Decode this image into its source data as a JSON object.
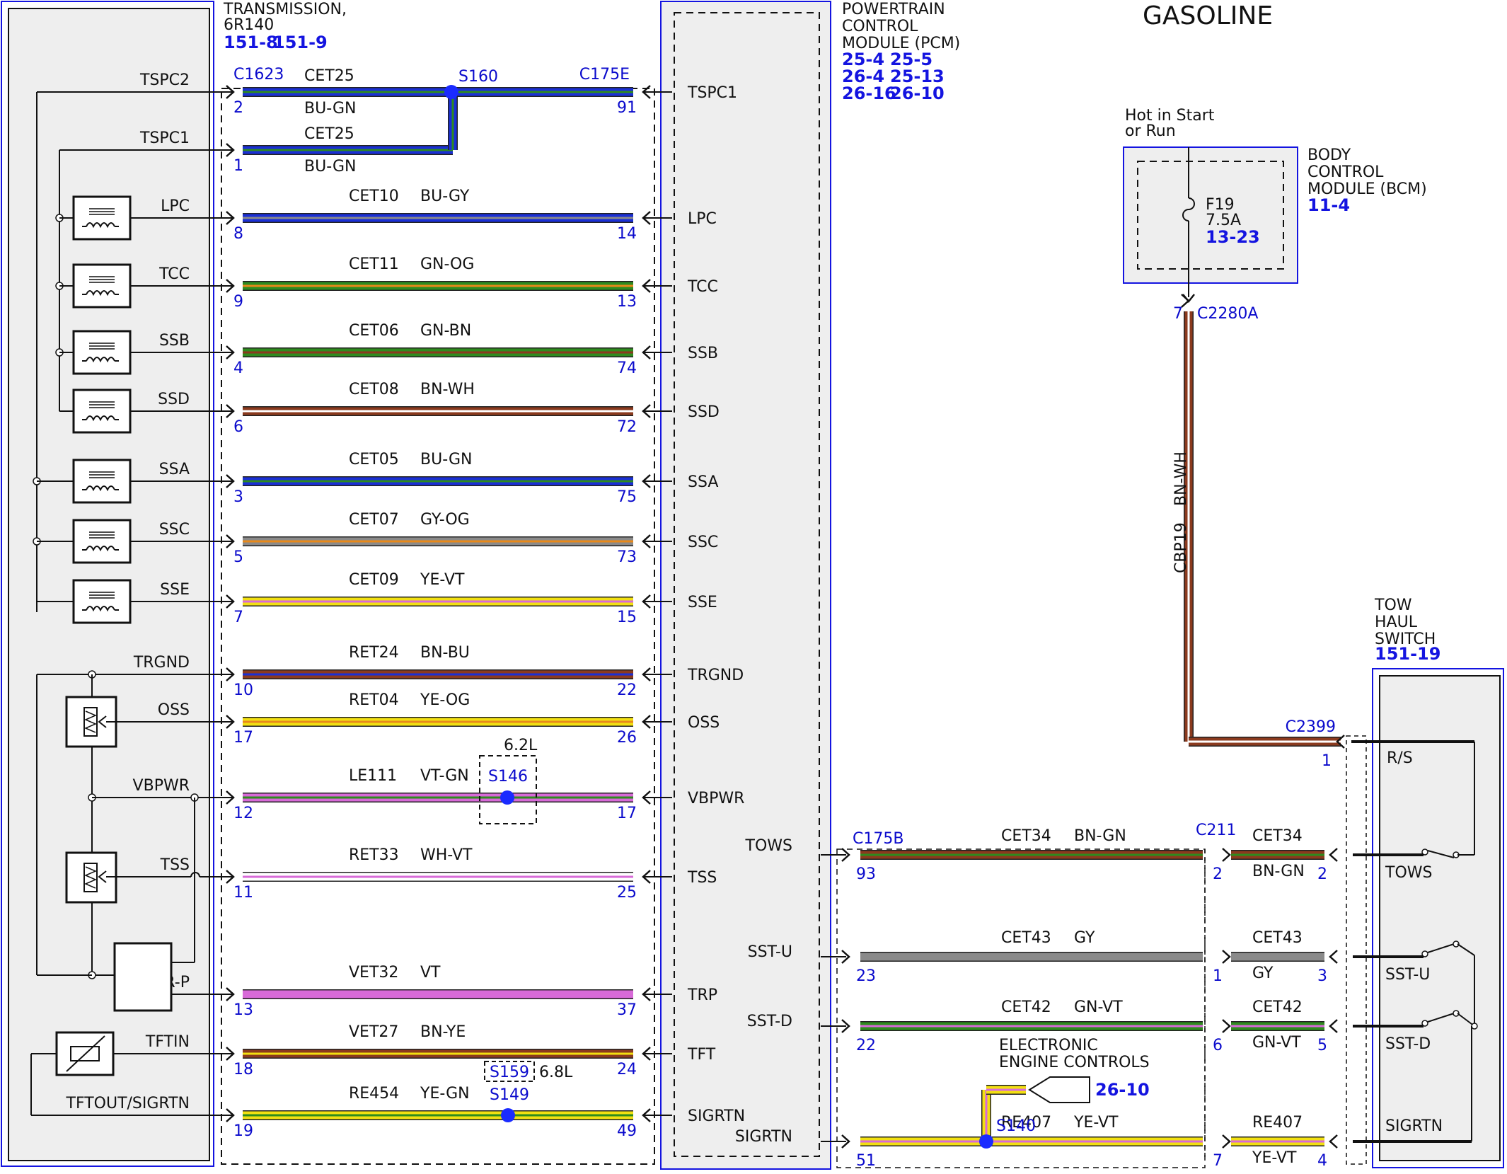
{
  "title": "GASOLINE",
  "colors": {
    "BU": "#1a2fd6",
    "GN": "#2e8b1e",
    "GY": "#8a8a8a",
    "OG": "#e8891a",
    "BN": "#8b3a1e",
    "WH": "#ffffff",
    "YE": "#f2e011",
    "VT": "#d86ad8",
    "black": "#111111",
    "blue": "#1414e0",
    "box_fill": "#eeeeee",
    "splice": "#1a2bff"
  },
  "transmission": {
    "title_lines": [
      "TRANSMISSION,",
      "6R140"
    ],
    "refs": [
      "151-8",
      "151-9"
    ]
  },
  "pcm": {
    "title_lines": [
      "POWERTRAIN",
      "CONTROL",
      "MODULE (PCM)"
    ],
    "refs": [
      [
        "25-4",
        "25-5"
      ],
      [
        "26-4",
        "25-13"
      ],
      [
        "26-16",
        "26-10"
      ]
    ]
  },
  "bcm": {
    "title_lines": [
      "BODY",
      "CONTROL",
      "MODULE (BCM)"
    ],
    "ref": "11-4",
    "feed_lines": [
      "Hot in Start",
      "or Run"
    ],
    "fuse": "F19",
    "fuse_rating": "7.5A",
    "fuse_ref": "13-23",
    "connector": "C2280A",
    "pin": "7",
    "circuit": "CBP19",
    "color": "BN-WH"
  },
  "tow_switch": {
    "title_lines": [
      "TOW",
      "HAUL",
      "SWITCH"
    ],
    "ref": "151-19",
    "r_s_label": "R/S",
    "r_s_connector": "C2399",
    "r_s_pin": "1",
    "contacts": [
      "TOWS",
      "SST-U",
      "SST-D",
      "SIGRTN"
    ]
  },
  "left_connector": "C1623",
  "right_connector": "C175E",
  "splice_s160": "S160",
  "signals": [
    {
      "name": "TSPC2",
      "circuit": "CET25",
      "color": "BU-GN",
      "pin_left": "2",
      "pin_right": "91",
      "pcm_label": "TSPC1"
    },
    {
      "name": "TSPC1",
      "circuit": "CET25",
      "color": "BU-GN",
      "pin_left": "1",
      "pin_right": "",
      "pcm_label": ""
    },
    {
      "name": "LPC",
      "circuit": "CET10",
      "color": "BU-GY",
      "pin_left": "8",
      "pin_right": "14",
      "pcm_label": "LPC"
    },
    {
      "name": "TCC",
      "circuit": "CET11",
      "color": "GN-OG",
      "pin_left": "9",
      "pin_right": "13",
      "pcm_label": "TCC"
    },
    {
      "name": "SSB",
      "circuit": "CET06",
      "color": "GN-BN",
      "pin_left": "4",
      "pin_right": "74",
      "pcm_label": "SSB"
    },
    {
      "name": "SSD",
      "circuit": "CET08",
      "color": "BN-WH",
      "pin_left": "6",
      "pin_right": "72",
      "pcm_label": "SSD"
    },
    {
      "name": "SSA",
      "circuit": "CET05",
      "color": "BU-GN",
      "pin_left": "3",
      "pin_right": "75",
      "pcm_label": "SSA"
    },
    {
      "name": "SSC",
      "circuit": "CET07",
      "color": "GY-OG",
      "pin_left": "5",
      "pin_right": "73",
      "pcm_label": "SSC"
    },
    {
      "name": "SSE",
      "circuit": "CET09",
      "color": "YE-VT",
      "pin_left": "7",
      "pin_right": "15",
      "pcm_label": "SSE"
    },
    {
      "name": "TRGND",
      "circuit": "RET24",
      "color": "BN-BU",
      "pin_left": "10",
      "pin_right": "22",
      "pcm_label": "TRGND"
    },
    {
      "name": "OSS",
      "circuit": "RET04",
      "color": "YE-OG",
      "pin_left": "17",
      "pin_right": "26",
      "pcm_label": "OSS"
    },
    {
      "name": "VBPWR",
      "circuit": "LE111",
      "color": "VT-GN",
      "pin_left": "12",
      "pin_right": "17",
      "pcm_label": "VBPWR"
    },
    {
      "name": "TSS",
      "circuit": "RET33",
      "color": "WH-VT",
      "pin_left": "11",
      "pin_right": "25",
      "pcm_label": "TSS"
    },
    {
      "name": "TRS/TR-P",
      "circuit": "VET32",
      "color": "VT",
      "pin_left": "13",
      "pin_right": "37",
      "pcm_label": "TRP"
    },
    {
      "name": "TFTIN",
      "circuit": "VET27",
      "color": "BN-YE",
      "pin_left": "18",
      "pin_right": "24",
      "pcm_label": "TFT"
    },
    {
      "name": "TFTOUT/SIGRTN",
      "circuit": "RE454",
      "color": "YE-GN",
      "pin_left": "19",
      "pin_right": "49",
      "pcm_label": "SIGRTN"
    }
  ],
  "splices": {
    "s146": "S146",
    "s146_note": "6.2L",
    "s159": "S159",
    "s159_note": "6.8L",
    "s149": "S149",
    "s140": "S140"
  },
  "lower_right": {
    "connector_pcm": "C175B",
    "connector_mid": "C211",
    "eec_lines": [
      "ELECTRONIC",
      "ENGINE CONTROLS"
    ],
    "eec_ref": "26-10",
    "wires": [
      {
        "pcm_label": "TOWS",
        "circuit": "CET34",
        "color": "BN-GN",
        "pin_pcm": "93",
        "pin_mid_left": "2",
        "circuit2": "CET34",
        "color2": "BN-GN",
        "pin_sw": "2"
      },
      {
        "pcm_label": "SST-U",
        "circuit": "CET43",
        "color": "GY",
        "pin_pcm": "23",
        "pin_mid_left": "1",
        "circuit2": "CET43",
        "color2": "GY",
        "pin_sw": "3"
      },
      {
        "pcm_label": "SST-D",
        "circuit": "CET42",
        "color": "GN-VT",
        "pin_pcm": "22",
        "pin_mid_left": "6",
        "circuit2": "CET42",
        "color2": "GN-VT",
        "pin_sw": "5"
      },
      {
        "pcm_label": "SIGRTN",
        "circuit": "RE407",
        "color": "YE-VT",
        "pin_pcm": "51",
        "pin_mid_left": "7",
        "circuit2": "RE407",
        "color2": "YE-VT",
        "pin_sw": "4"
      }
    ]
  }
}
